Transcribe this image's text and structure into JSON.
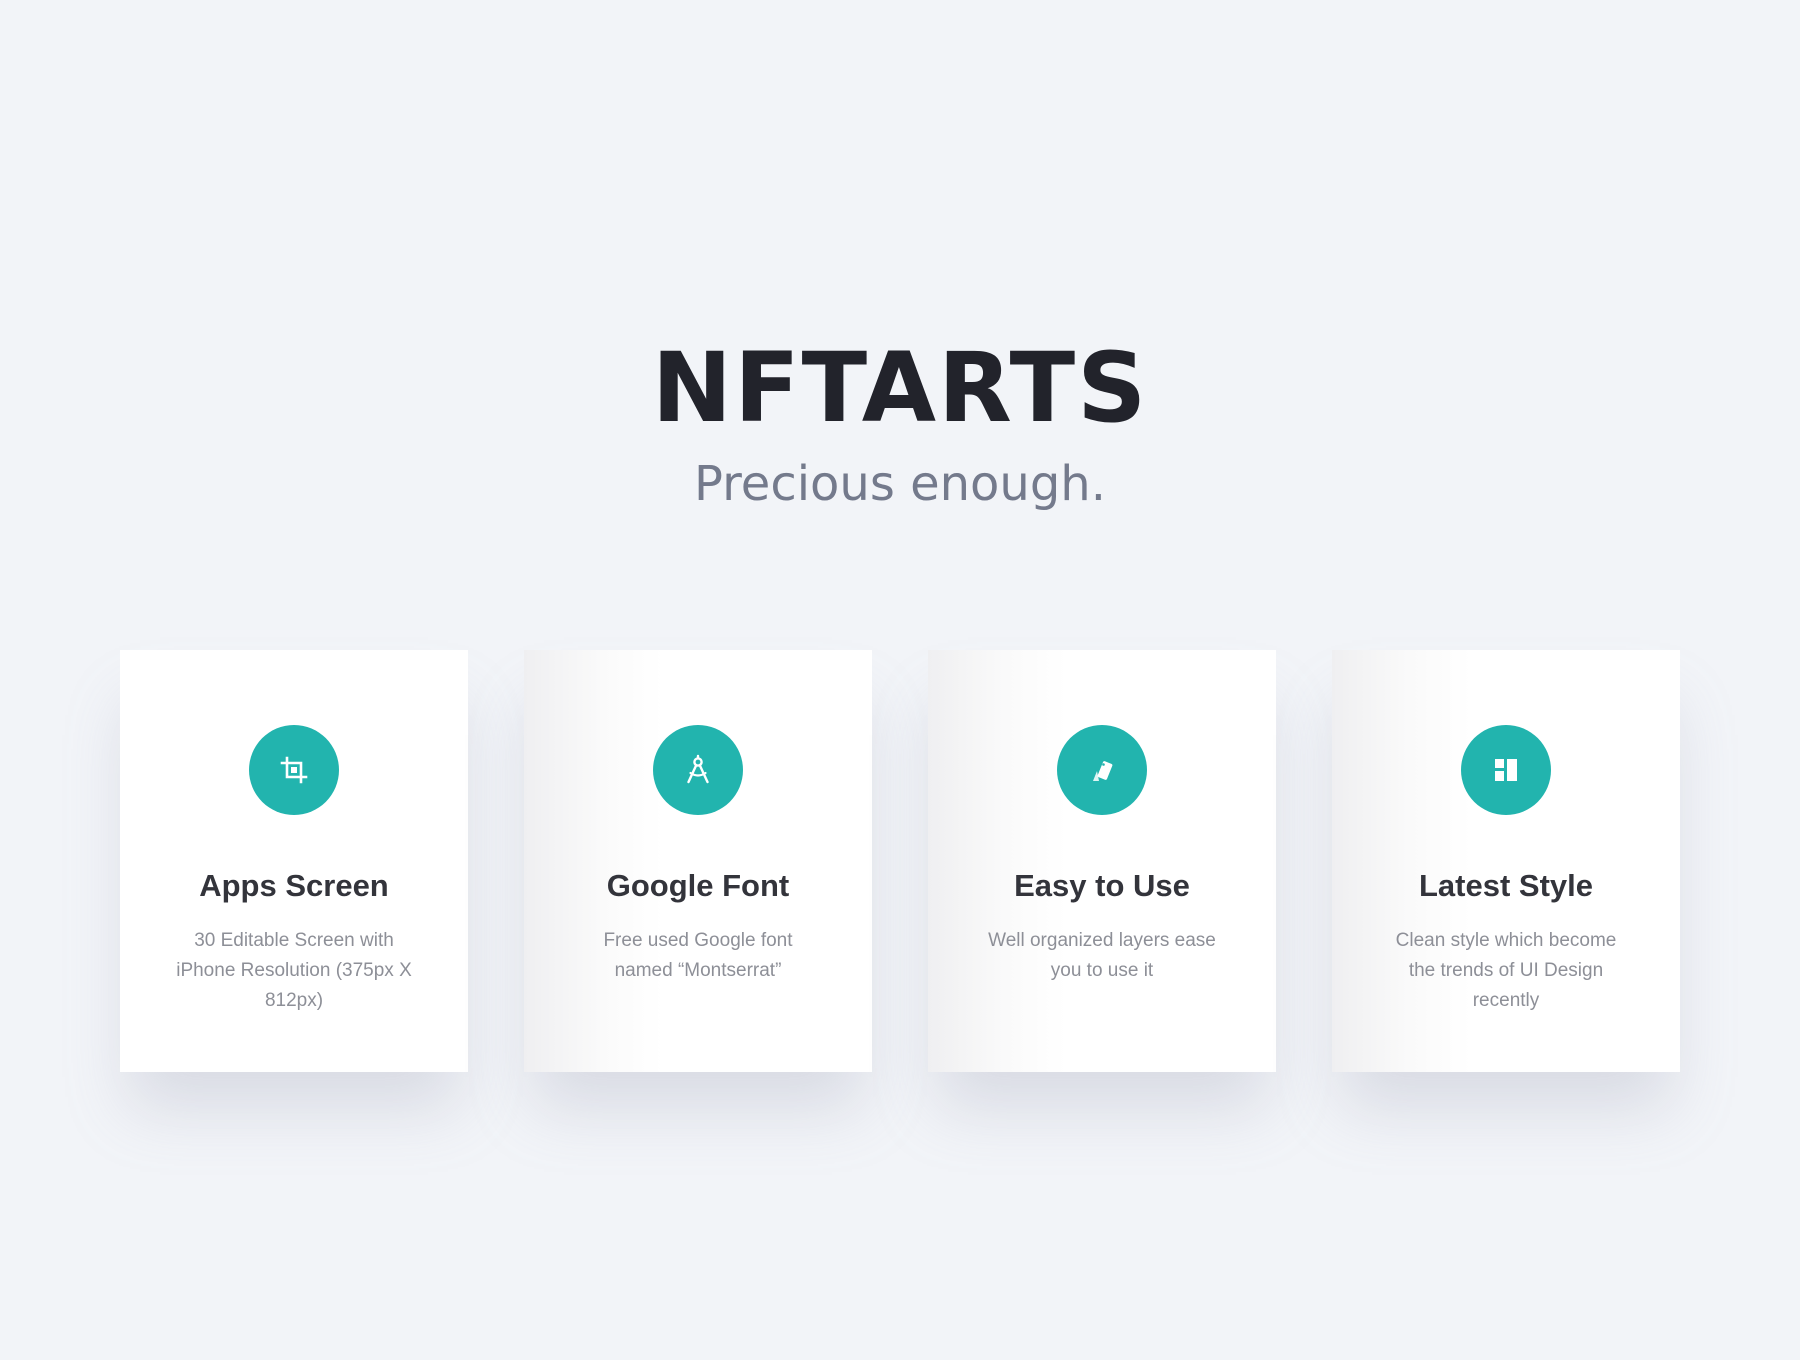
{
  "header": {
    "brand": "NFTARTS",
    "tagline": "Precious enough."
  },
  "features": [
    {
      "icon": "crop-icon",
      "title": "Apps Screen",
      "description": "30 Editable Screen with iPhone Resolution (375px X 812px)"
    },
    {
      "icon": "compass-icon",
      "title": "Google Font",
      "description": "Free used Google font named “Montserrat”"
    },
    {
      "icon": "swatches-icon",
      "title": "Easy to Use",
      "description": "Well organized layers ease you to use it"
    },
    {
      "icon": "layout-icon",
      "title": "Latest Style",
      "description": "Clean style which become the trends of UI Design recently"
    }
  ],
  "colors": {
    "background": "#f2f4f8",
    "accent": "#22b4ae",
    "brand_text": "#22232b",
    "tagline_text": "#747a8c"
  }
}
